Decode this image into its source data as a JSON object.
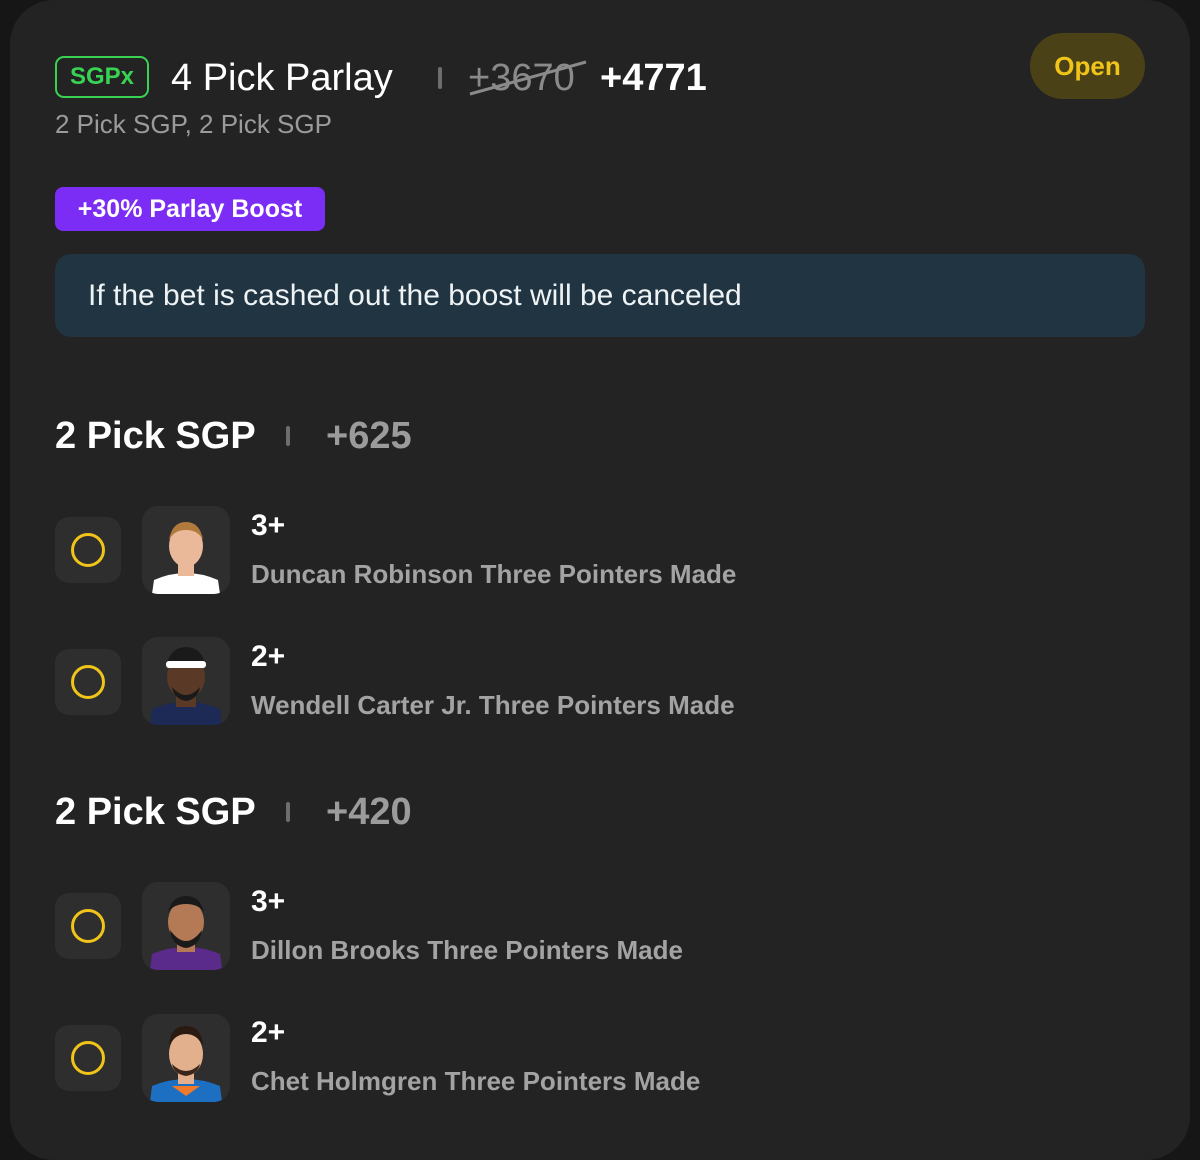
{
  "bet": {
    "tag": "SGPx",
    "title": "4 Pick Parlay",
    "original_odds": "+3670",
    "boosted_odds": "+4771",
    "subtitle": "2 Pick SGP, 2 Pick SGP",
    "status": "Open",
    "boost_label": "+30% Parlay Boost",
    "notice": "If the bet is cashed out the boost will be canceled"
  },
  "sections": [
    {
      "title": "2 Pick SGP",
      "odds": "+625",
      "picks": [
        {
          "line": "3+",
          "description": "Duncan Robinson Three Pointers Made",
          "avatar_icon": "player-headshot",
          "jersey_color": "#ffffff",
          "skin": "#e9b99a",
          "hair": "#b07a3c"
        },
        {
          "line": "2+",
          "description": "Wendell Carter Jr. Three Pointers Made",
          "avatar_icon": "player-headshot",
          "jersey_color": "#1c2a55",
          "skin": "#5a3a26",
          "hair": "#1a1a1a"
        }
      ]
    },
    {
      "title": "2 Pick SGP",
      "odds": "+420",
      "picks": [
        {
          "line": "3+",
          "description": "Dillon Brooks Three Pointers Made",
          "avatar_icon": "player-headshot",
          "jersey_color": "#5b2b8c",
          "skin": "#b47a56",
          "hair": "#1a1a1a"
        },
        {
          "line": "2+",
          "description": "Chet Holmgren Three Pointers Made",
          "avatar_icon": "player-headshot",
          "jersey_color": "#1d6fc2",
          "skin": "#e2b08c",
          "hair": "#2a1a12"
        }
      ]
    }
  ],
  "colors": {
    "accent_green": "#39d353",
    "accent_yellow": "#f0c419",
    "boost_purple": "#7b2cf5",
    "notice_bg": "#213441"
  }
}
